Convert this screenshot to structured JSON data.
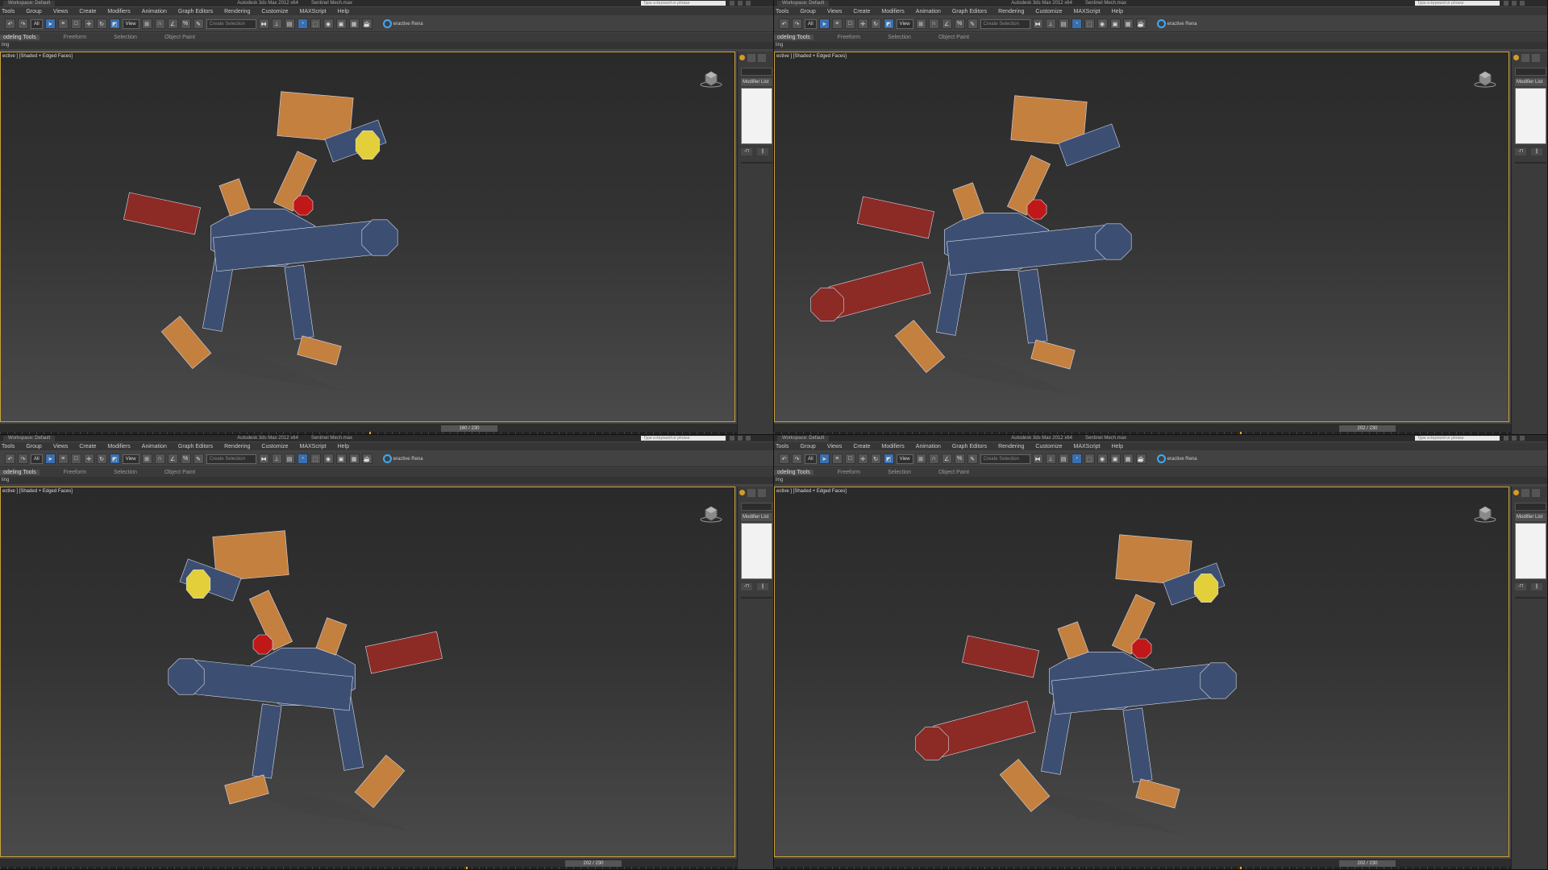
{
  "windows": [
    {
      "workspace": "Workspace: Default",
      "app_title": "Autodesk 3ds Max 2012 x64",
      "file_name": "Sentinel Mech.max",
      "search_placeholder": "Type a keyword or phrase",
      "menu": [
        "Tools",
        "Group",
        "Views",
        "Create",
        "Modifiers",
        "Animation",
        "Graph Editors",
        "Rendering",
        "Customize",
        "MAXScript",
        "Help"
      ],
      "selection_filter": "All",
      "coord_system": "View",
      "named_selection": "Create Selection",
      "render_label": "eractive Rena",
      "ribbon_tabs": [
        "odeling Tools",
        "Freeform",
        "Selection",
        "Object Paint"
      ],
      "ribbon_sub": "ling",
      "viewport_label": "ective ] [Shaded + Edged Faces]",
      "modifier_list": "Modifier List",
      "time_slider": "160 / 230",
      "time_fraction": 0.696
    },
    {
      "workspace": "Workspace: Default",
      "app_title": "Autodesk 3ds Max 2012 x64",
      "file_name": "Sentinel Mech.max",
      "search_placeholder": "Type a keyword or phrase",
      "menu": [
        "Tools",
        "Group",
        "Views",
        "Create",
        "Modifiers",
        "Animation",
        "Graph Editors",
        "Rendering",
        "Customize",
        "MAXScript",
        "Help"
      ],
      "selection_filter": "All",
      "coord_system": "View",
      "named_selection": "Create Selection",
      "render_label": "eractive Rena",
      "ribbon_tabs": [
        "odeling Tools",
        "Freeform",
        "Selection",
        "Object Paint"
      ],
      "ribbon_sub": "ling",
      "viewport_label": "ective ] [Shaded + Edged Faces]",
      "modifier_list": "Modifier List",
      "time_slider": "202 / 230",
      "time_fraction": 0.878
    },
    {
      "workspace": "Workspace: Default",
      "app_title": "Autodesk 3ds Max 2012 x64",
      "file_name": "Sentinel Mech.max",
      "search_placeholder": "Type a keyword or phrase",
      "menu": [
        "Tools",
        "Group",
        "Views",
        "Create",
        "Modifiers",
        "Animation",
        "Graph Editors",
        "Rendering",
        "Customize",
        "MAXScript",
        "Help"
      ],
      "selection_filter": "All",
      "coord_system": "View",
      "named_selection": "Create Selection",
      "render_label": "eractive Rena",
      "ribbon_tabs": [
        "odeling Tools",
        "Freeform",
        "Selection",
        "Object Paint"
      ],
      "ribbon_sub": "ling",
      "viewport_label": "ective ] [Shaded + Edged Faces]",
      "modifier_list": "Modifier List",
      "time_slider": "202 / 230",
      "time_fraction": 0.878
    },
    {
      "workspace": "Workspace: Default",
      "app_title": "Autodesk 3ds Max 2012 x64",
      "file_name": "Sentinel Mech.max",
      "search_placeholder": "Type a keyword or phrase",
      "menu": [
        "Tools",
        "Group",
        "Views",
        "Create",
        "Modifiers",
        "Animation",
        "Graph Editors",
        "Rendering",
        "Customize",
        "MAXScript",
        "Help"
      ],
      "selection_filter": "All",
      "coord_system": "View",
      "named_selection": "Create Selection",
      "render_label": "eractive Rena",
      "ribbon_tabs": [
        "odeling Tools",
        "Freeform",
        "Selection",
        "Object Paint"
      ],
      "ribbon_sub": "ling",
      "viewport_label": "ective ] [Shaded + Edged Faces]",
      "modifier_list": "Modifier List",
      "time_slider": "202 / 230",
      "time_fraction": 0.878
    }
  ],
  "colors": {
    "armor_orange": "#c4803f",
    "armor_blue": "#3c4f73",
    "armor_red": "#8c2a25",
    "visor_yellow": "#e3cf3a",
    "eye_red": "#c01818",
    "viewport_border": "#c8a23c",
    "time_marker": "#e6b01e"
  },
  "icons": [
    "undo-icon",
    "redo-icon",
    "select-icon",
    "move-icon",
    "rotate-icon",
    "scale-icon",
    "snap-icon",
    "mirror-icon",
    "align-icon",
    "render-icon",
    "viewcube-icon",
    "light-icon"
  ]
}
